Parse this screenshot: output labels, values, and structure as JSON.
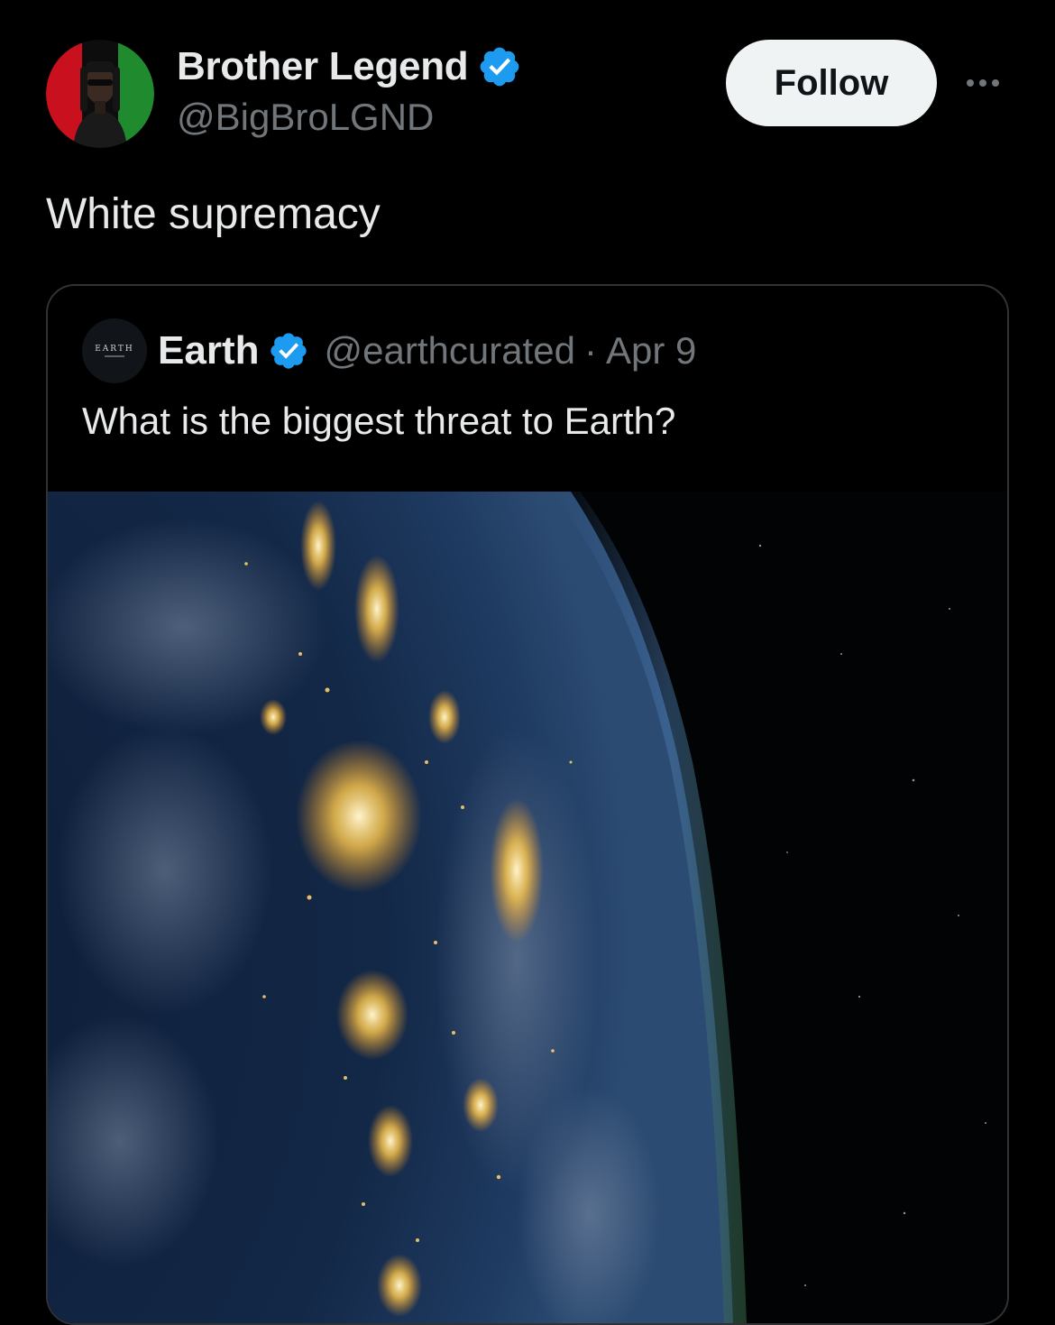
{
  "tweet": {
    "author": {
      "name": "Brother Legend",
      "handle": "@BigBroLGND",
      "verified": true
    },
    "follow_label": "Follow",
    "more_icon": "more-horizontal-icon",
    "text": "White supremacy"
  },
  "quote": {
    "author": {
      "name": "Earth",
      "handle": "@earthcurated",
      "verified": true,
      "avatar_text": "EARTH"
    },
    "separator": "·",
    "date": "Apr 9",
    "text": "What is the biggest threat to Earth?",
    "image_subject": "earth-at-night-from-space"
  },
  "colors": {
    "background": "#000000",
    "text_primary": "#e7e9ea",
    "text_secondary": "#71767b",
    "verified_blue": "#1d9bf0",
    "border": "#2f3336",
    "follow_bg": "#eff3f4"
  }
}
